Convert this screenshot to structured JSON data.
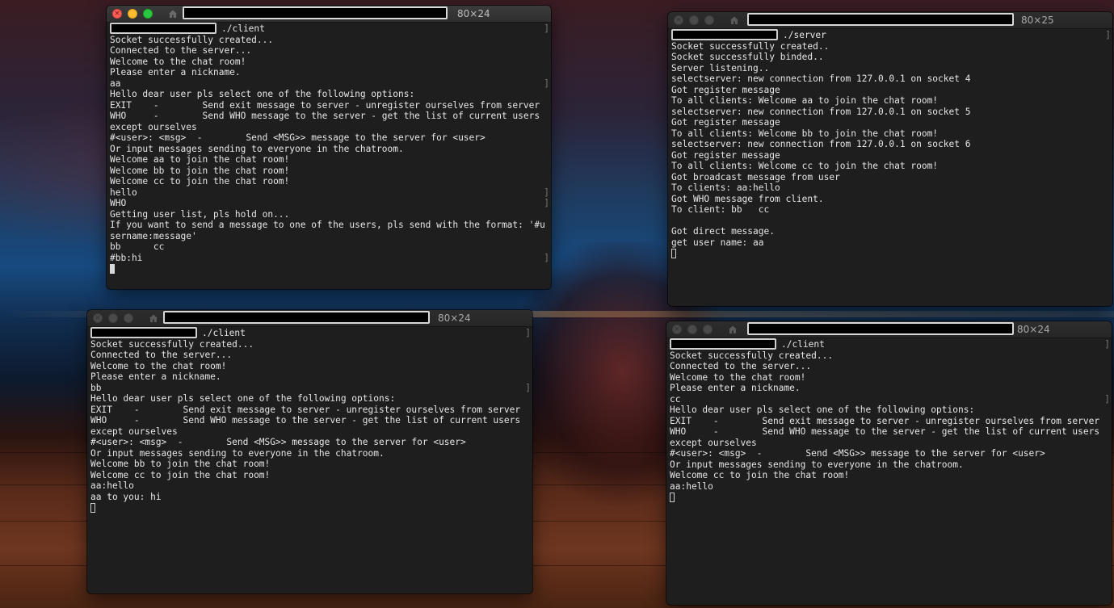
{
  "desktop": {
    "wallpaper": "blue-night-city-with-red-car-and-wood-floor"
  },
  "colors": {
    "terminal_bg": "#1e1e1e",
    "terminal_text": "#e6e6e6",
    "close": "#fe5f57",
    "minimize": "#febc2e",
    "maximize": "#28c840",
    "redaction": "#000000"
  },
  "windows": [
    {
      "id": "client-aa",
      "state": "active",
      "title_size": "80×24",
      "lines": [
        {
          "text": "./client",
          "prompt": true,
          "mark": true
        },
        {
          "text": "Socket successfully created..."
        },
        {
          "text": "Connected to the server..."
        },
        {
          "text": "Welcome to the chat room!"
        },
        {
          "text": "Please enter a nickname."
        },
        {
          "text": "aa",
          "mark": true
        },
        {
          "text": "Hello dear user pls select one of the following options:"
        },
        {
          "text": "EXIT    -        Send exit message to server - unregister ourselves from server"
        },
        {
          "text": "WHO     -        Send WHO message to the server - get the list of current users"
        },
        {
          "text": "except ourselves"
        },
        {
          "text": "#<user>: <msg>  -        Send <MSG>> message to the server for <user>"
        },
        {
          "text": "Or input messages sending to everyone in the chatroom."
        },
        {
          "text": "Welcome aa to join the chat room!"
        },
        {
          "text": "Welcome bb to join the chat room!"
        },
        {
          "text": "Welcome cc to join the chat room!"
        },
        {
          "text": "hello",
          "mark": true
        },
        {
          "text": "WHO",
          "mark": true
        },
        {
          "text": "Getting user list, pls hold on..."
        },
        {
          "text": "If you want to send a message to one of the users, pls send with the format: '#u"
        },
        {
          "text": "sername:message'"
        },
        {
          "text": "bb      cc"
        },
        {
          "text": "#bb:hi",
          "mark": true
        },
        {
          "text": "",
          "cursor": "solid"
        }
      ]
    },
    {
      "id": "server",
      "state": "inactive",
      "title_size": "80×25",
      "lines": [
        {
          "text": "./server",
          "prompt": true,
          "mark": true
        },
        {
          "text": "Socket successfully created.."
        },
        {
          "text": "Socket successfully binded.."
        },
        {
          "text": "Server listening.."
        },
        {
          "text": "selectserver: new connection from 127.0.0.1 on socket 4"
        },
        {
          "text": "Got register message"
        },
        {
          "text": "To all clients: Welcome aa to join the chat room!"
        },
        {
          "text": "selectserver: new connection from 127.0.0.1 on socket 5"
        },
        {
          "text": "Got register message"
        },
        {
          "text": "To all clients: Welcome bb to join the chat room!"
        },
        {
          "text": "selectserver: new connection from 127.0.0.1 on socket 6"
        },
        {
          "text": "Got register message"
        },
        {
          "text": "To all clients: Welcome cc to join the chat room!"
        },
        {
          "text": "Got broadcast message from user"
        },
        {
          "text": "To clients: aa:hello"
        },
        {
          "text": "Got WHO message from client."
        },
        {
          "text": "To client: bb   cc"
        },
        {
          "text": ""
        },
        {
          "text": "Got direct message."
        },
        {
          "text": "get user name: aa"
        },
        {
          "text": "",
          "cursor": "hollow"
        }
      ]
    },
    {
      "id": "client-bb",
      "state": "inactive",
      "title_size": "80×24",
      "lines": [
        {
          "text": "./client",
          "prompt": true,
          "mark": true
        },
        {
          "text": "Socket successfully created..."
        },
        {
          "text": "Connected to the server..."
        },
        {
          "text": "Welcome to the chat room!"
        },
        {
          "text": "Please enter a nickname."
        },
        {
          "text": "bb",
          "mark": true
        },
        {
          "text": "Hello dear user pls select one of the following options:"
        },
        {
          "text": "EXIT    -        Send exit message to server - unregister ourselves from server"
        },
        {
          "text": "WHO     -        Send WHO message to the server - get the list of current users"
        },
        {
          "text": "except ourselves"
        },
        {
          "text": "#<user>: <msg>  -        Send <MSG>> message to the server for <user>"
        },
        {
          "text": "Or input messages sending to everyone in the chatroom."
        },
        {
          "text": "Welcome bb to join the chat room!"
        },
        {
          "text": "Welcome cc to join the chat room!"
        },
        {
          "text": "aa:hello"
        },
        {
          "text": "aa to you: hi"
        },
        {
          "text": "",
          "cursor": "hollow"
        }
      ]
    },
    {
      "id": "client-cc",
      "state": "inactive",
      "title_size": "80×24",
      "lines": [
        {
          "text": "./client",
          "prompt": true,
          "mark": true
        },
        {
          "text": "Socket successfully created..."
        },
        {
          "text": "Connected to the server..."
        },
        {
          "text": "Welcome to the chat room!"
        },
        {
          "text": "Please enter a nickname."
        },
        {
          "text": "cc",
          "mark": true
        },
        {
          "text": "Hello dear user pls select one of the following options:"
        },
        {
          "text": "EXIT    -        Send exit message to server - unregister ourselves from server"
        },
        {
          "text": "WHO     -        Send WHO message to the server - get the list of current users"
        },
        {
          "text": "except ourselves"
        },
        {
          "text": "#<user>: <msg>  -        Send <MSG>> message to the server for <user>"
        },
        {
          "text": "Or input messages sending to everyone in the chatroom."
        },
        {
          "text": "Welcome cc to join the chat room!"
        },
        {
          "text": "aa:hello"
        },
        {
          "text": "",
          "cursor": "hollow"
        }
      ]
    }
  ]
}
